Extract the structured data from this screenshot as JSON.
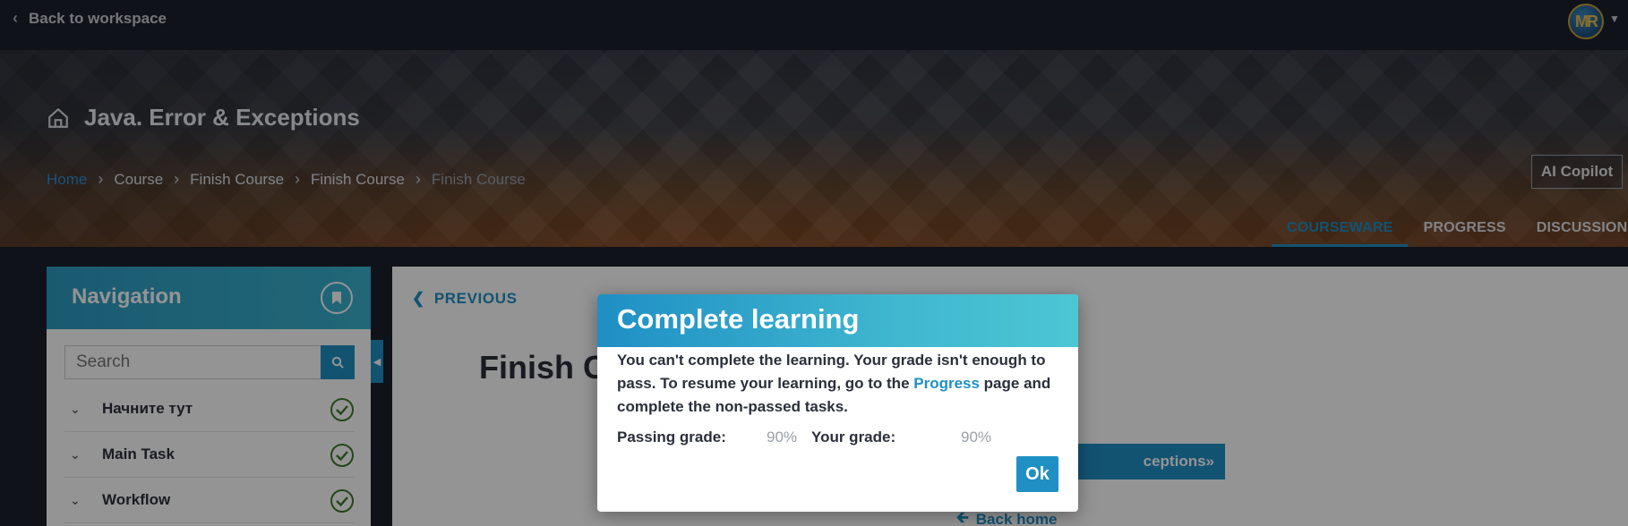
{
  "topbar": {
    "back_label": "Back to workspace",
    "avatar_initials": "MR"
  },
  "course": {
    "title": "Java. Error & Exceptions"
  },
  "breadcrumb": {
    "home": "Home",
    "items": [
      "Course",
      "Finish Course",
      "Finish Course"
    ],
    "current": "Finish Course"
  },
  "ai_copilot_label": "AI Copilot",
  "tabs": [
    {
      "label": "COURSEWARE",
      "active": true
    },
    {
      "label": "PROGRESS",
      "active": false
    },
    {
      "label": "DISCUSSION",
      "active": false
    }
  ],
  "navigation": {
    "title": "Navigation",
    "search_placeholder": "Search",
    "items": [
      {
        "label": "Начните тут"
      },
      {
        "label": "Main Task"
      },
      {
        "label": "Workflow"
      }
    ]
  },
  "content": {
    "previous_label": "PREVIOUS",
    "title_visible": "Finish Co",
    "next_module_label_visible": "ceptions»",
    "back_home_label": "Back home"
  },
  "modal": {
    "title": "Complete learning",
    "message_part1": "You can't complete the learning. Your grade isn't enough to pass. To resume your learning, go to the ",
    "link_text": "Progress",
    "message_part2": " page and complete the non-passed tasks.",
    "passing_label": "Passing grade:",
    "passing_value": "90%",
    "your_label": "Your grade:",
    "your_value": "90%",
    "ok_label": "Ok"
  },
  "colors": {
    "accent": "#1f8fc4",
    "check": "#3d7a26"
  }
}
